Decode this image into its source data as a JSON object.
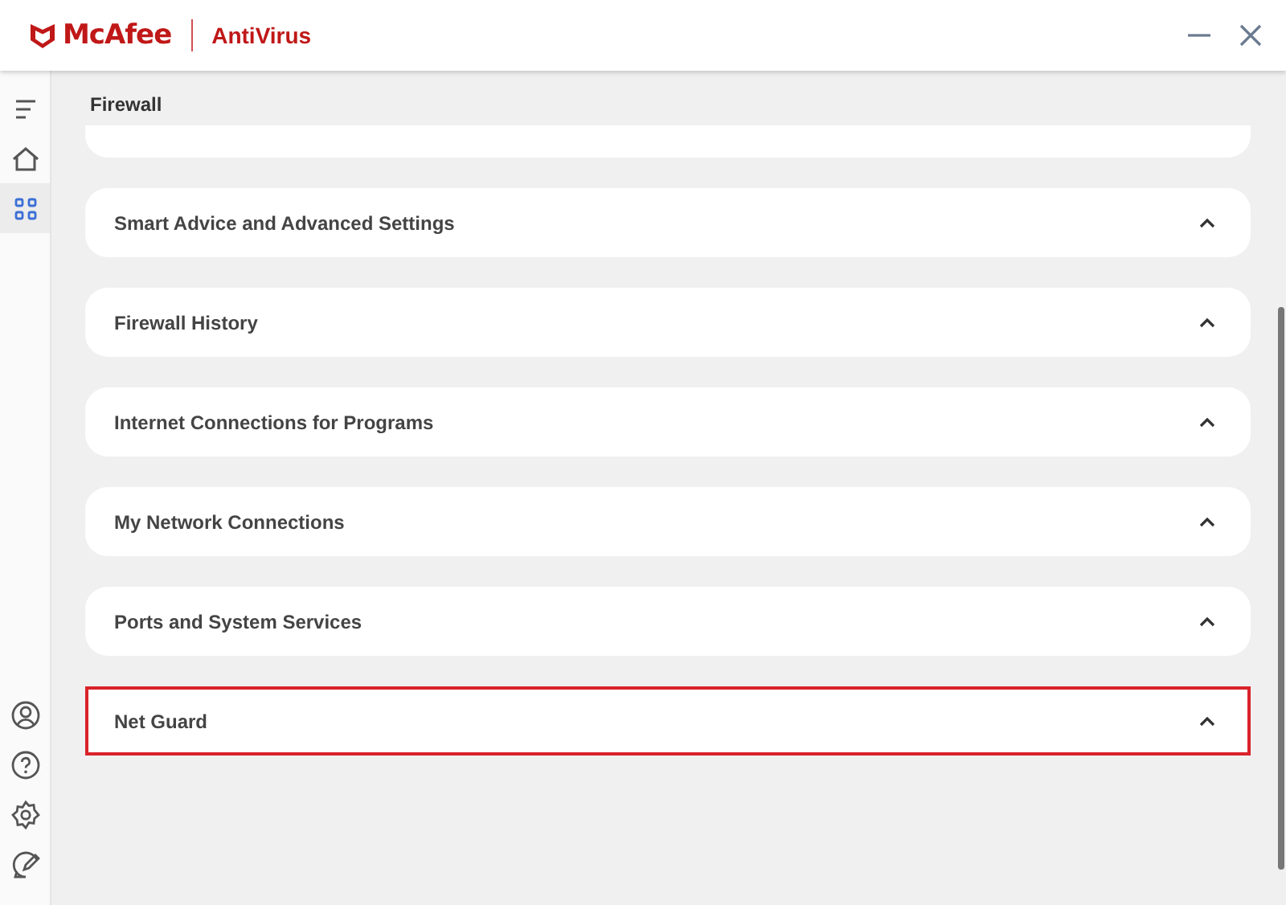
{
  "window": {
    "brand": "McAfee",
    "product": "AntiVirus"
  },
  "sidebar": {
    "top_items": [
      {
        "kind": "menu",
        "selected": false
      },
      {
        "kind": "home",
        "selected": false
      },
      {
        "kind": "apps",
        "selected": true
      }
    ],
    "bottom_items": [
      {
        "kind": "account",
        "selected": false
      },
      {
        "kind": "help",
        "selected": false
      },
      {
        "kind": "settings",
        "selected": false
      },
      {
        "kind": "feedback",
        "selected": false
      }
    ]
  },
  "page": {
    "title": "Firewall"
  },
  "sections": [
    {
      "label": "Smart Advice and Advanced Settings",
      "highlighted": false
    },
    {
      "label": "Firewall History",
      "highlighted": false
    },
    {
      "label": "Internet Connections for Programs",
      "highlighted": false
    },
    {
      "label": "My Network Connections",
      "highlighted": false
    },
    {
      "label": "Ports and System Services",
      "highlighted": false
    },
    {
      "label": "Net Guard",
      "highlighted": true
    }
  ]
}
